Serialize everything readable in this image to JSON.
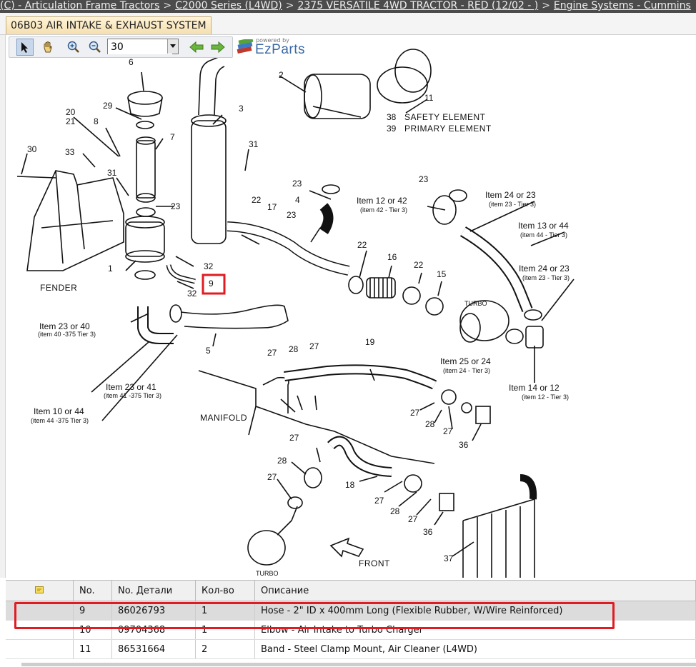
{
  "breadcrumb": [
    "(C) - Articulation Frame Tractors",
    "C2000 Series (L4WD)",
    "2375 VERSATILE 4WD TRACTOR - RED (12/02 - )",
    "Engine Systems - Cummins"
  ],
  "tab": {
    "label": "06B03 AIR INTAKE & EXHAUST SYSTEM"
  },
  "toolbar": {
    "zoom_value": "30",
    "icons": [
      "pointer-arrow-icon",
      "hand-pan-icon",
      "zoom-in-icon",
      "zoom-out-icon",
      "arrow-left-icon",
      "arrow-right-icon"
    ]
  },
  "logo": {
    "powered": "powered by",
    "name": "EzParts"
  },
  "diagram": {
    "labels": {
      "n6": "6",
      "n2": "2",
      "n29": "29",
      "n20": "20",
      "n21": "21",
      "n8": "8",
      "n7": "7",
      "n3": "3",
      "n30": "30",
      "n33": "33",
      "n31a": "31",
      "n31b": "31",
      "n23a": "23",
      "n1": "1",
      "n32a": "32",
      "n32b": "32",
      "n9": "9",
      "n4": "4",
      "n23b": "23",
      "n23c": "23",
      "n22a": "22",
      "n17": "17",
      "n22b": "22",
      "n16": "16",
      "n22c": "22",
      "n15": "15",
      "n11": "11",
      "n38": "38",
      "n39": "39",
      "n23d": "23",
      "n5": "5",
      "n27a": "27",
      "n28a": "28",
      "n27b": "27",
      "n19": "19",
      "n27c": "27",
      "n28b": "28",
      "n27d": "27",
      "n36a": "36",
      "n27e": "27",
      "n28c": "28",
      "n27f": "27",
      "n18": "18",
      "n27g": "27",
      "n28d": "28",
      "n27h": "27",
      "n36b": "36",
      "n37": "37"
    },
    "captions": {
      "safety": "SAFETY ELEMENT",
      "primary": "PRIMARY ELEMENT",
      "fender": "FENDER",
      "manifold": "MANIFOLD",
      "front": "FRONT",
      "turbo1": "TURBO",
      "turbo2": "TURBO"
    },
    "items": {
      "i1242": "Item 12 or 42",
      "i1242s": "(item 42 - Tier 3)",
      "i2423a": "Item 24 or 23",
      "i2423as": "(item 23 - Tier 3)",
      "i1344": "Item 13 or 44",
      "i1344s": "(item 44 - Tier 3)",
      "i2423b": "Item 24 or 23",
      "i2423bs": "(item 23 - Tier 3)",
      "i2340": "Item 23 or 40",
      "i2340s": "(item 40 -375 Tier 3)",
      "i2341": "Item 23 or 41",
      "i2341s": "(item 41 -375 Tier 3)",
      "i1044": "Item 10 or 44",
      "i1044s": "(item 44 -375 Tier 3)",
      "i2524": "Item 25 or 24",
      "i2524s": "(item 24 - Tier 3)",
      "i1412": "Item 14 or 12",
      "i1412s": "(item 12 - Tier 3)"
    }
  },
  "parts_table": {
    "headers": [
      "",
      "No.",
      "No. Детали",
      "Кол-во",
      "Описание"
    ],
    "rows": [
      {
        "no": "9",
        "part": "86026793",
        "qty": "1",
        "desc": "Hose - 2\" ID x 400mm Long (Flexible Rubber, W/Wire Reinforced)"
      },
      {
        "no": "10",
        "part": "09704368",
        "qty": "1",
        "desc": "Elbow - Air Intake to Turbo Charger"
      },
      {
        "no": "11",
        "part": "86531664",
        "qty": "2",
        "desc": "Band - Steel Clamp Mount, Air Cleaner (L4WD)"
      }
    ]
  },
  "colors": {
    "highlight": "#e11b22",
    "selected_row": "#dcdcdc",
    "breadcrumb_bg": "#4b4b4b",
    "tab_bg": "#f5dfb0"
  }
}
